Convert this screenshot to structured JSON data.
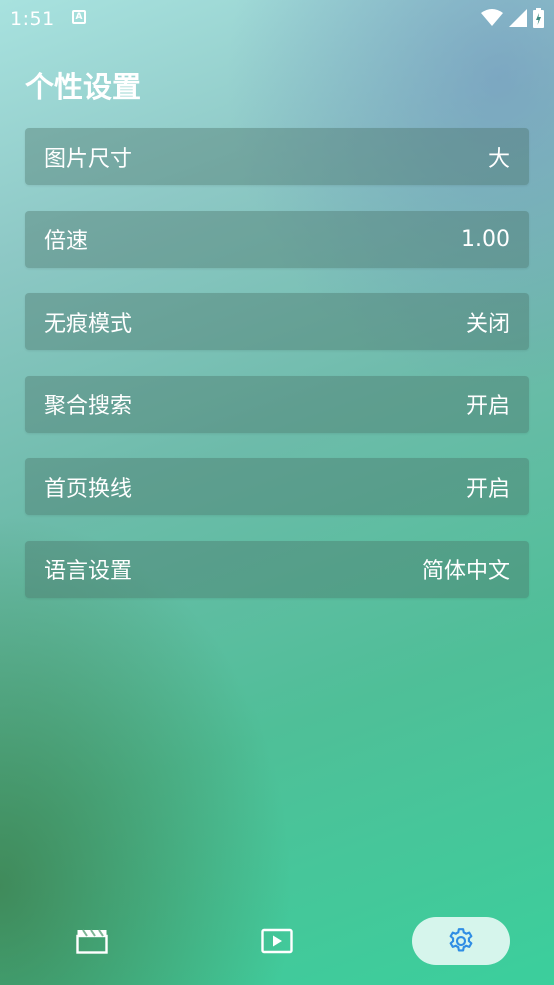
{
  "status_bar": {
    "time": "1:51",
    "notification_letter": "A"
  },
  "page": {
    "title": "个性设置"
  },
  "settings": [
    {
      "label": "图片尺寸",
      "value": "大"
    },
    {
      "label": "倍速",
      "value": "1.00"
    },
    {
      "label": "无痕模式",
      "value": "关闭"
    },
    {
      "label": "聚合搜索",
      "value": "开启"
    },
    {
      "label": "首页换线",
      "value": "开启"
    },
    {
      "label": "语言设置",
      "value": "简体中文"
    }
  ],
  "bottom_nav": {
    "items": [
      {
        "icon": "movie-clapper-icon",
        "active": false
      },
      {
        "icon": "play-icon",
        "active": false
      },
      {
        "icon": "gear-icon",
        "active": true
      }
    ]
  },
  "colors": {
    "active_icon": "#2f8de4",
    "active_pill": "#d6f5ec"
  }
}
